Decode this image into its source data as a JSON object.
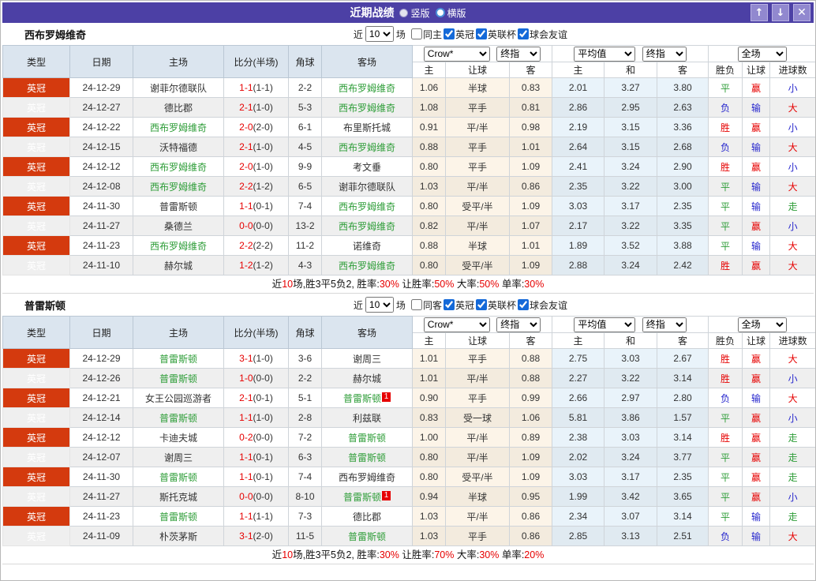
{
  "titlebar": {
    "title": "近期战绩",
    "radio_vertical": "竖版",
    "radio_horizontal": "横版",
    "buttons": {
      "up": "↑",
      "down": "↓",
      "close": "✕"
    }
  },
  "colors": {
    "titlebar_bg": "#4c40a5",
    "league_badge": "#d43a0e",
    "self_team_green": "#2e9d38",
    "win_red": "#e60000",
    "loss_blue": "#2525cd",
    "header_bg": "#dbe5ef",
    "crow_col_bg": "#fcf4e8",
    "avg_col_bg": "#e9f3fa"
  },
  "table": {
    "columns": [
      "类型",
      "日期",
      "主场",
      "比分(半场)",
      "角球",
      "客场"
    ],
    "odds_groups": {
      "crow": "Crow*",
      "final1": "终指",
      "avg": "平均值",
      "final2": "终指",
      "full": "全场"
    },
    "subcolumns": [
      "主",
      "让球",
      "客",
      "主",
      "和",
      "客",
      "胜负",
      "让球",
      "进球数"
    ]
  },
  "row_fields": [
    "league",
    "date",
    "home",
    "home_is_self",
    "home_redcard",
    "score",
    "half",
    "corners",
    "away",
    "away_is_self",
    "away_redcard",
    "crow_home",
    "crow_handicap",
    "crow_away",
    "avg_home",
    "avg_draw",
    "avg_away",
    "result",
    "handicap_result",
    "goals_result"
  ],
  "sections": [
    {
      "team": "西布罗姆维奇",
      "filters": {
        "near_label": "近",
        "count": "10",
        "games_label": "场",
        "same_label": "同主",
        "same_checked": false,
        "leagues": [
          {
            "label": "英冠",
            "checked": true
          },
          {
            "label": "英联杯",
            "checked": true
          },
          {
            "label": "球会友谊",
            "checked": true
          }
        ]
      },
      "rows": [
        [
          "英冠",
          "24-12-29",
          "谢菲尔德联队",
          false,
          null,
          "1-1",
          "(1-1)",
          "2-2",
          "西布罗姆维奇",
          true,
          null,
          "1.06",
          "半球",
          "0.83",
          "2.01",
          "3.27",
          "3.80",
          "平",
          "赢",
          "小"
        ],
        [
          "英冠",
          "24-12-27",
          "德比郡",
          false,
          null,
          "2-1",
          "(1-0)",
          "5-3",
          "西布罗姆维奇",
          true,
          null,
          "1.08",
          "平手",
          "0.81",
          "2.86",
          "2.95",
          "2.63",
          "负",
          "输",
          "大"
        ],
        [
          "英冠",
          "24-12-22",
          "西布罗姆维奇",
          true,
          null,
          "2-0",
          "(2-0)",
          "6-1",
          "布里斯托城",
          false,
          null,
          "0.91",
          "平/半",
          "0.98",
          "2.19",
          "3.15",
          "3.36",
          "胜",
          "赢",
          "小"
        ],
        [
          "英冠",
          "24-12-15",
          "沃特福德",
          false,
          null,
          "2-1",
          "(1-0)",
          "4-5",
          "西布罗姆维奇",
          true,
          null,
          "0.88",
          "平手",
          "1.01",
          "2.64",
          "3.15",
          "2.68",
          "负",
          "输",
          "大"
        ],
        [
          "英冠",
          "24-12-12",
          "西布罗姆维奇",
          true,
          null,
          "2-0",
          "(1-0)",
          "9-9",
          "考文垂",
          false,
          null,
          "0.80",
          "平手",
          "1.09",
          "2.41",
          "3.24",
          "2.90",
          "胜",
          "赢",
          "小"
        ],
        [
          "英冠",
          "24-12-08",
          "西布罗姆维奇",
          true,
          null,
          "2-2",
          "(1-2)",
          "6-5",
          "谢菲尔德联队",
          false,
          null,
          "1.03",
          "平/半",
          "0.86",
          "2.35",
          "3.22",
          "3.00",
          "平",
          "输",
          "大"
        ],
        [
          "英冠",
          "24-11-30",
          "普雷斯顿",
          false,
          null,
          "1-1",
          "(0-1)",
          "7-4",
          "西布罗姆维奇",
          true,
          null,
          "0.80",
          "受平/半",
          "1.09",
          "3.03",
          "3.17",
          "2.35",
          "平",
          "输",
          "走"
        ],
        [
          "英冠",
          "24-11-27",
          "桑德兰",
          false,
          null,
          "0-0",
          "(0-0)",
          "13-2",
          "西布罗姆维奇",
          true,
          null,
          "0.82",
          "平/半",
          "1.07",
          "2.17",
          "3.22",
          "3.35",
          "平",
          "赢",
          "小"
        ],
        [
          "英冠",
          "24-11-23",
          "西布罗姆维奇",
          true,
          null,
          "2-2",
          "(2-2)",
          "11-2",
          "诺维奇",
          false,
          null,
          "0.88",
          "半球",
          "1.01",
          "1.89",
          "3.52",
          "3.88",
          "平",
          "输",
          "大"
        ],
        [
          "英冠",
          "24-11-10",
          "赫尔城",
          false,
          null,
          "1-2",
          "(1-2)",
          "4-3",
          "西布罗姆维奇",
          true,
          null,
          "0.80",
          "受平/半",
          "1.09",
          "2.88",
          "3.24",
          "2.42",
          "胜",
          "赢",
          "大"
        ]
      ],
      "summary": [
        {
          "text": "近"
        },
        {
          "text": "10",
          "red": true
        },
        {
          "text": "场,胜3平5负2, 胜率:"
        },
        {
          "text": "30%",
          "red": true
        },
        {
          "text": " 让胜率:"
        },
        {
          "text": "50%",
          "red": true
        },
        {
          "text": " 大率:"
        },
        {
          "text": "50%",
          "red": true
        },
        {
          "text": " 单率:"
        },
        {
          "text": "30%",
          "red": true
        }
      ]
    },
    {
      "team": "普雷斯顿",
      "filters": {
        "near_label": "近",
        "count": "10",
        "games_label": "场",
        "same_label": "同客",
        "same_checked": false,
        "leagues": [
          {
            "label": "英冠",
            "checked": true
          },
          {
            "label": "英联杯",
            "checked": true
          },
          {
            "label": "球会友谊",
            "checked": true
          }
        ]
      },
      "rows": [
        [
          "英冠",
          "24-12-29",
          "普雷斯顿",
          true,
          null,
          "3-1",
          "(1-0)",
          "3-6",
          "谢周三",
          false,
          null,
          "1.01",
          "平手",
          "0.88",
          "2.75",
          "3.03",
          "2.67",
          "胜",
          "赢",
          "大"
        ],
        [
          "英冠",
          "24-12-26",
          "普雷斯顿",
          true,
          null,
          "1-0",
          "(0-0)",
          "2-2",
          "赫尔城",
          false,
          null,
          "1.01",
          "平/半",
          "0.88",
          "2.27",
          "3.22",
          "3.14",
          "胜",
          "赢",
          "小"
        ],
        [
          "英冠",
          "24-12-21",
          "女王公园巡游者",
          false,
          null,
          "2-1",
          "(0-1)",
          "5-1",
          "普雷斯顿",
          true,
          "1",
          "0.90",
          "平手",
          "0.99",
          "2.66",
          "2.97",
          "2.80",
          "负",
          "输",
          "大"
        ],
        [
          "英冠",
          "24-12-14",
          "普雷斯顿",
          true,
          null,
          "1-1",
          "(1-0)",
          "2-8",
          "利兹联",
          false,
          null,
          "0.83",
          "受一球",
          "1.06",
          "5.81",
          "3.86",
          "1.57",
          "平",
          "赢",
          "小"
        ],
        [
          "英冠",
          "24-12-12",
          "卡迪夫城",
          false,
          null,
          "0-2",
          "(0-0)",
          "7-2",
          "普雷斯顿",
          true,
          null,
          "1.00",
          "平/半",
          "0.89",
          "2.38",
          "3.03",
          "3.14",
          "胜",
          "赢",
          "走"
        ],
        [
          "英冠",
          "24-12-07",
          "谢周三",
          false,
          null,
          "1-1",
          "(0-1)",
          "6-3",
          "普雷斯顿",
          true,
          null,
          "0.80",
          "平/半",
          "1.09",
          "2.02",
          "3.24",
          "3.77",
          "平",
          "赢",
          "走"
        ],
        [
          "英冠",
          "24-11-30",
          "普雷斯顿",
          true,
          null,
          "1-1",
          "(0-1)",
          "7-4",
          "西布罗姆维奇",
          false,
          null,
          "0.80",
          "受平/半",
          "1.09",
          "3.03",
          "3.17",
          "2.35",
          "平",
          "赢",
          "走"
        ],
        [
          "英冠",
          "24-11-27",
          "斯托克城",
          false,
          null,
          "0-0",
          "(0-0)",
          "8-10",
          "普雷斯顿",
          true,
          "1",
          "0.94",
          "半球",
          "0.95",
          "1.99",
          "3.42",
          "3.65",
          "平",
          "赢",
          "小"
        ],
        [
          "英冠",
          "24-11-23",
          "普雷斯顿",
          true,
          null,
          "1-1",
          "(1-1)",
          "7-3",
          "德比郡",
          false,
          null,
          "1.03",
          "平/半",
          "0.86",
          "2.34",
          "3.07",
          "3.14",
          "平",
          "输",
          "走"
        ],
        [
          "英冠",
          "24-11-09",
          "朴茨茅斯",
          false,
          null,
          "3-1",
          "(2-0)",
          "11-5",
          "普雷斯顿",
          true,
          null,
          "1.03",
          "平手",
          "0.86",
          "2.85",
          "3.13",
          "2.51",
          "负",
          "输",
          "大"
        ]
      ],
      "summary": [
        {
          "text": "近"
        },
        {
          "text": "10",
          "red": true
        },
        {
          "text": "场,胜3平5负2, 胜率:"
        },
        {
          "text": "30%",
          "red": true
        },
        {
          "text": " 让胜率:"
        },
        {
          "text": "70%",
          "red": true
        },
        {
          "text": " 大率:"
        },
        {
          "text": "30%",
          "red": true
        },
        {
          "text": " 单率:"
        },
        {
          "text": "20%",
          "red": true
        }
      ]
    }
  ]
}
